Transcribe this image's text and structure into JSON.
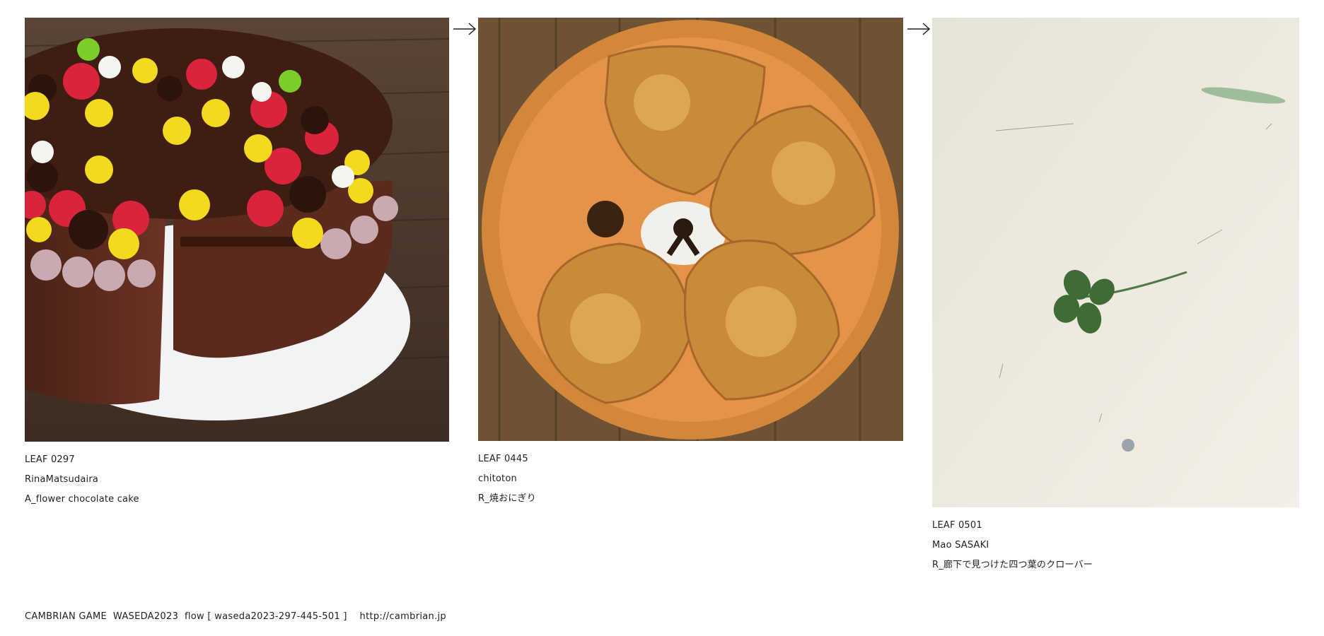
{
  "leaves": [
    {
      "number": "LEAF 0297",
      "author": "RinaMatsudaira",
      "title": "A_flower chocolate cake",
      "icon": "chocolate-cake-photo"
    },
    {
      "number": "LEAF 0445",
      "author": "chitoton",
      "title": "R_焼おにぎり",
      "icon": "rice-ball-plate-photo"
    },
    {
      "number": "LEAF 0501",
      "author": "Mao SASAKI",
      "title": "R_廊下で見つけた四つ葉のクローバー",
      "icon": "four-leaf-clover-photo"
    }
  ],
  "flow_arrow_glyph": "→",
  "footer": {
    "text": "CAMBRIAN GAME  WASEDA2023  flow [ waseda2023-297-445-501 ]    http://cambrian.jp"
  }
}
